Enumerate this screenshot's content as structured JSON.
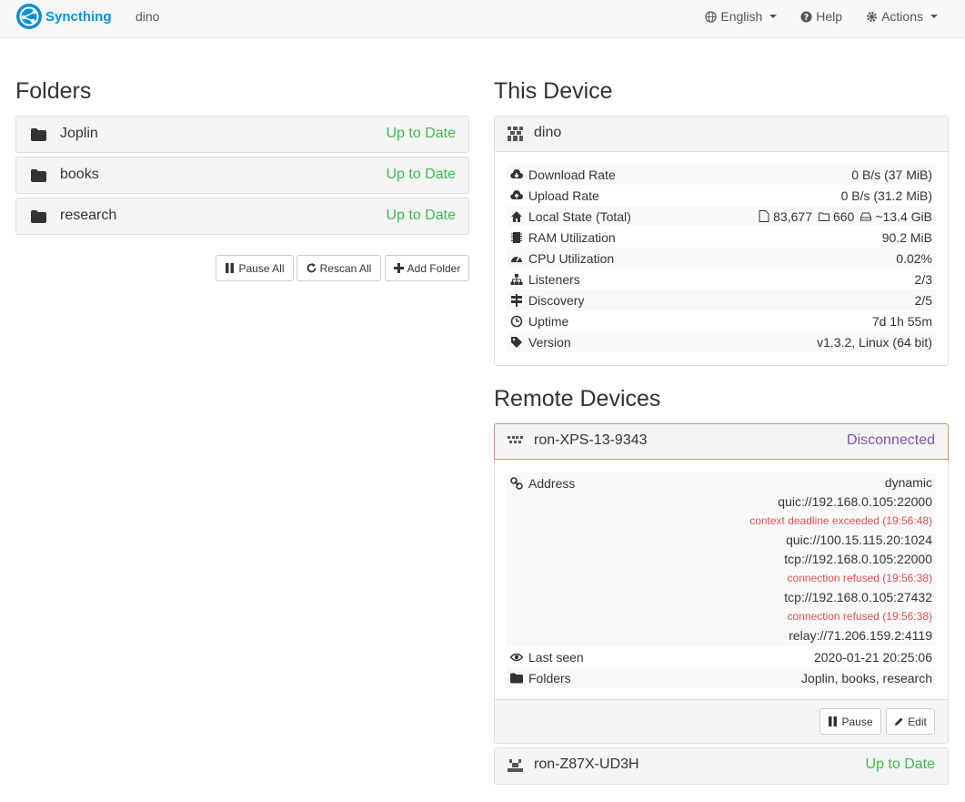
{
  "nav": {
    "brand": "Syncthing",
    "device": "dino",
    "language": "English",
    "help": "Help",
    "actions": "Actions"
  },
  "folders": {
    "title": "Folders",
    "items": [
      {
        "name": "Joplin",
        "status": "Up to Date"
      },
      {
        "name": "books",
        "status": "Up to Date"
      },
      {
        "name": "research",
        "status": "Up to Date"
      }
    ],
    "buttons": {
      "pause_all": "Pause All",
      "rescan_all": "Rescan All",
      "add_folder": "Add Folder"
    }
  },
  "this_device": {
    "title": "This Device",
    "name": "dino",
    "rows": [
      {
        "label": "Download Rate",
        "value": "0 B/s (37 MiB)"
      },
      {
        "label": "Upload Rate",
        "value": "0 B/s (31.2 MiB)"
      },
      {
        "label": "Local State (Total)",
        "files": "83,677",
        "dirs": "660",
        "size": "~13.4 GiB"
      },
      {
        "label": "RAM Utilization",
        "value": "90.2 MiB"
      },
      {
        "label": "CPU Utilization",
        "value": "0.02%"
      },
      {
        "label": "Listeners",
        "value": "2/3"
      },
      {
        "label": "Discovery",
        "value": "2/5"
      },
      {
        "label": "Uptime",
        "value": "7d 1h 55m"
      },
      {
        "label": "Version",
        "value": "v1.3.2, Linux (64 bit)"
      }
    ]
  },
  "remote": {
    "title": "Remote Devices",
    "device1": {
      "name": "ron-XPS-13-9343",
      "status": "Disconnected",
      "address_label": "Address",
      "addresses": [
        {
          "text": "dynamic",
          "error": false
        },
        {
          "text": "quic://192.168.0.105:22000",
          "error": false
        },
        {
          "text": "context deadline exceeded (19:56:48)",
          "error": true
        },
        {
          "text": "quic://100.15.115.20:1024",
          "error": false
        },
        {
          "text": "tcp://192.168.0.105:22000",
          "error": false
        },
        {
          "text": "connection refused (19:56:38)",
          "error": true
        },
        {
          "text": "tcp://192.168.0.105:27432",
          "error": false
        },
        {
          "text": "connection refused (19:56:38)",
          "error": true
        },
        {
          "text": "relay://71.206.159.2:4119",
          "error": false
        }
      ],
      "last_seen_label": "Last seen",
      "last_seen": "2020-01-21 20:25:06",
      "folders_label": "Folders",
      "folders": "Joplin, books, research",
      "pause": "Pause",
      "edit": "Edit"
    },
    "device2": {
      "name": "ron-Z87X-UD3H",
      "status": "Up to Date"
    }
  },
  "colors": {
    "brand": "#0891d1",
    "up_to_date": "#3fb850",
    "disconnected": "#7f4fae",
    "error": "#d9534f",
    "disconnected_border": "#e08a6a"
  }
}
